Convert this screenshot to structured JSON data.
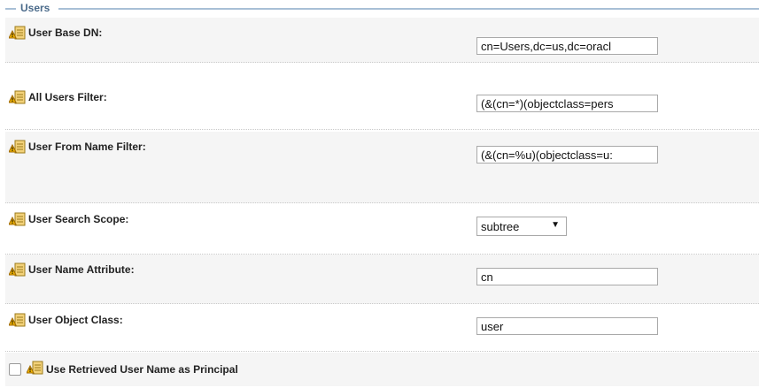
{
  "section": {
    "title": "Users"
  },
  "fields": [
    {
      "label": "User Base DN:",
      "value": "cn=Users,dc=us,dc=oracl"
    },
    {
      "label": "All Users Filter:",
      "value": "(&(cn=*)(objectclass=pers"
    },
    {
      "label": "User From Name Filter:",
      "value": "(&(cn=%u)(objectclass=u:"
    },
    {
      "label": "User Search Scope:",
      "value": "subtree"
    },
    {
      "label": "User Name Attribute:",
      "value": "cn"
    },
    {
      "label": "User Object Class:",
      "value": "user"
    }
  ],
  "checkbox": {
    "label": "Use Retrieved User Name as Principal",
    "checked": false
  },
  "icons": {
    "field_icon": "warning-config-icon",
    "dropdown": "triangle-down-icon"
  },
  "colors": {
    "legend_line": "#a8bfd6",
    "legend_text": "#4a6a8a",
    "row_shade": "#f5f5f5"
  }
}
